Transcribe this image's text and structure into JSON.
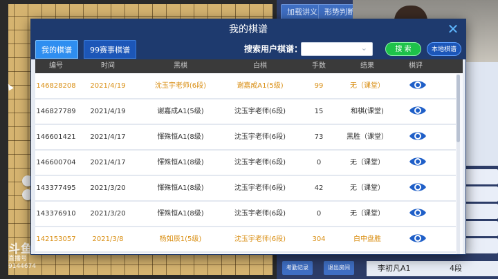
{
  "background": {
    "top_buttons": [
      "加载讲义",
      "形势判断"
    ],
    "bottom_buttons": [
      "考勤记录",
      "退出房间"
    ],
    "bottom_row": {
      "name": "李初凡A1",
      "level": "4段"
    },
    "watermark": {
      "logo": "斗鱼",
      "sub": "直播号",
      "id": "9144674"
    }
  },
  "modal": {
    "title": "我的棋谱",
    "close": "✕",
    "tabs": [
      {
        "label": "我的棋谱",
        "active": true
      },
      {
        "label": "99赛事棋谱",
        "active": false
      }
    ],
    "search": {
      "label": "搜索用户棋谱：",
      "placeholder": "",
      "button": "搜 索",
      "local_button": "本地棋谱"
    },
    "columns": [
      "编号",
      "时间",
      "黑棋",
      "白棋",
      "手数",
      "结果",
      "棋评"
    ],
    "rows": [
      {
        "id": "146828208",
        "date": "2021/4/19",
        "black": "沈玉宇老师(6段)",
        "white": "谢嘉成A1(5级)",
        "moves": "99",
        "result": "无（课堂）",
        "highlight": true
      },
      {
        "id": "146827789",
        "date": "2021/4/19",
        "black": "谢嘉成A1(5级)",
        "white": "沈玉宇老师(6段)",
        "moves": "15",
        "result": "和棋(课堂)",
        "highlight": false
      },
      {
        "id": "146601421",
        "date": "2021/4/17",
        "black": "惲殊恒A1(8级)",
        "white": "沈玉宇老师(6段)",
        "moves": "73",
        "result": "黑胜（课堂）",
        "highlight": false
      },
      {
        "id": "146600704",
        "date": "2021/4/17",
        "black": "惲殊恒A1(8级)",
        "white": "沈玉宇老师(6段)",
        "moves": "0",
        "result": "无（课堂）",
        "highlight": false
      },
      {
        "id": "143377495",
        "date": "2021/3/20",
        "black": "惲殊恒A1(8级)",
        "white": "沈玉宇老师(6段)",
        "moves": "42",
        "result": "无（课堂）",
        "highlight": false
      },
      {
        "id": "143376910",
        "date": "2021/3/20",
        "black": "惲殊恒A1(8级)",
        "white": "沈玉宇老师(6段)",
        "moves": "0",
        "result": "无（课堂）",
        "highlight": false
      },
      {
        "id": "142153057",
        "date": "2021/3/8",
        "black": "杨如辰1(5级)",
        "white": "沈玉宇老师(6段)",
        "moves": "304",
        "result": "白中盘胜",
        "highlight": true
      }
    ],
    "colors": {
      "header": "#1e3a6e",
      "highlight_text": "#d98e12",
      "search_green": "#1ec24a",
      "eye_blue": "#1f5fc8"
    }
  }
}
